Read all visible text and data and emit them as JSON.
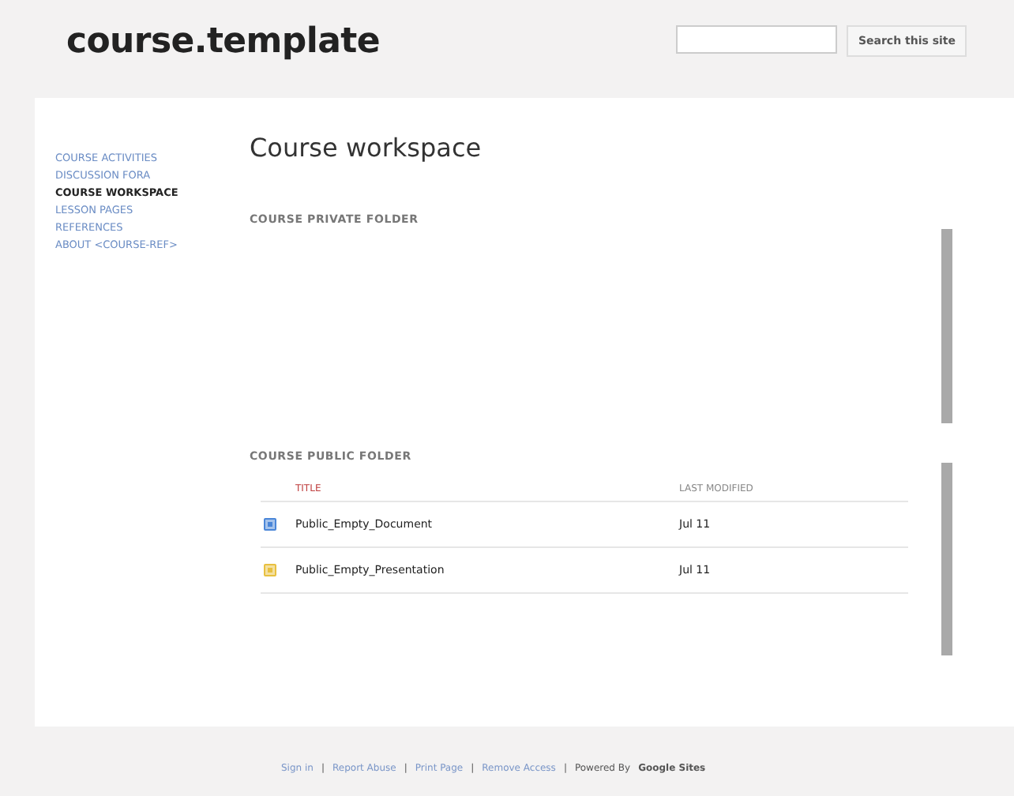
{
  "site_title": "course.template",
  "search": {
    "button": "Search this site"
  },
  "sidebar": {
    "items": [
      {
        "label": "COURSE ACTIVITIES",
        "selected": false
      },
      {
        "label": "DISCUSSION FORA",
        "selected": false
      },
      {
        "label": "COURSE WORKSPACE",
        "selected": true
      },
      {
        "label": "LESSON PAGES",
        "selected": false
      },
      {
        "label": "REFERENCES",
        "selected": false
      },
      {
        "label": "ABOUT <COURSE-REF>",
        "selected": false
      }
    ]
  },
  "page_title": "Course workspace",
  "private_folder": {
    "heading": "COURSE PRIVATE FOLDER"
  },
  "public_folder": {
    "heading": "COURSE PUBLIC FOLDER",
    "columns": [
      "TITLE",
      "LAST MODIFIED"
    ],
    "rows": [
      {
        "title": "Public_Empty_Document",
        "modified": "Jul 11",
        "color": "#4a86d8"
      },
      {
        "title": "Public_Empty_Presentation",
        "modified": "Jul 11",
        "color": "#e8c040"
      }
    ]
  },
  "footer": [
    {
      "kind": "link",
      "text": "Sign in"
    },
    {
      "kind": "separator",
      "text": "|"
    },
    {
      "kind": "link",
      "text": "Report Abuse"
    },
    {
      "kind": "separator",
      "text": "|"
    },
    {
      "kind": "link",
      "text": "Print Page"
    },
    {
      "kind": "separator",
      "text": "|"
    },
    {
      "kind": "link",
      "text": "Remove Access"
    },
    {
      "kind": "separator",
      "text": "|"
    },
    {
      "kind": "plain",
      "text": "Powered By"
    },
    {
      "kind": "brand",
      "text": "Google Sites"
    }
  ]
}
